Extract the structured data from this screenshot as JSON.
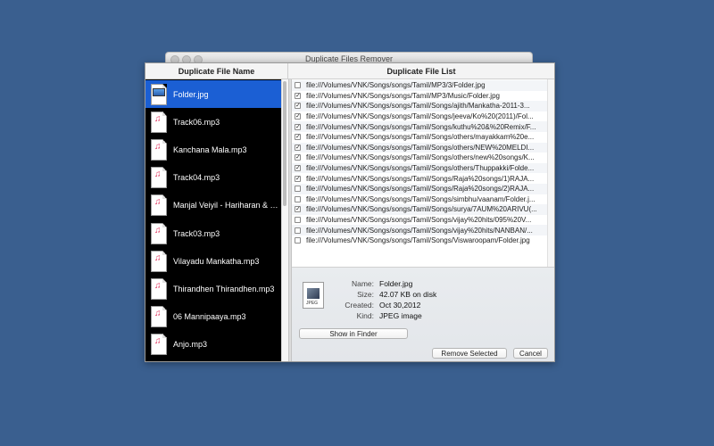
{
  "window": {
    "title": "Duplicate Files Remover"
  },
  "headers": {
    "left": "Duplicate File Name",
    "right": "Duplicate File List"
  },
  "files": [
    {
      "name": "Folder.jpg",
      "type": "image",
      "selected": true
    },
    {
      "name": "Track06.mp3",
      "type": "audio",
      "selected": false
    },
    {
      "name": "Kanchana Mala.mp3",
      "type": "audio",
      "selected": false
    },
    {
      "name": "Track04.mp3",
      "type": "audio",
      "selected": false
    },
    {
      "name": "Manjal Veiyil - Hariharan & Vija...",
      "type": "audio",
      "selected": false
    },
    {
      "name": "Track03.mp3",
      "type": "audio",
      "selected": false
    },
    {
      "name": "Vilayadu Mankatha.mp3",
      "type": "audio",
      "selected": false
    },
    {
      "name": "Thirandhen Thirandhen.mp3",
      "type": "audio",
      "selected": false
    },
    {
      "name": "06 Mannipaaya.mp3",
      "type": "audio",
      "selected": false
    },
    {
      "name": "Anjo.mp3",
      "type": "audio",
      "selected": false
    }
  ],
  "duplicates": [
    {
      "path": "file:///Volumes/VNK/Songs/songs/Tamil/MP3/3/Folder.jpg",
      "checked": false
    },
    {
      "path": "file:///Volumes/VNK/Songs/songs/Tamil/MP3/Music/Folder.jpg",
      "checked": true
    },
    {
      "path": "file:///Volumes/VNK/Songs/songs/Tamil/Songs/ajith/Mankatha-2011-3...",
      "checked": true
    },
    {
      "path": "file:///Volumes/VNK/Songs/songs/Tamil/Songs/jeeva/Ko%20(2011)/Fol...",
      "checked": true
    },
    {
      "path": "file:///Volumes/VNK/Songs/songs/Tamil/Songs/kuthu%20&%20Remix/F...",
      "checked": true
    },
    {
      "path": "file:///Volumes/VNK/Songs/songs/Tamil/Songs/others/mayakkam%20e...",
      "checked": true
    },
    {
      "path": "file:///Volumes/VNK/Songs/songs/Tamil/Songs/others/NEW%20MELDI...",
      "checked": true
    },
    {
      "path": "file:///Volumes/VNK/Songs/songs/Tamil/Songs/others/new%20songs/K...",
      "checked": true
    },
    {
      "path": "file:///Volumes/VNK/Songs/songs/Tamil/Songs/others/Thuppakki/Folde...",
      "checked": true
    },
    {
      "path": "file:///Volumes/VNK/Songs/songs/Tamil/Songs/Raja%20songs/1)RAJA...",
      "checked": true
    },
    {
      "path": "file:///Volumes/VNK/Songs/songs/Tamil/Songs/Raja%20songs/2)RAJA...",
      "checked": false
    },
    {
      "path": "file:///Volumes/VNK/Songs/songs/Tamil/Songs/simbhu/vaanam/Folder.j...",
      "checked": false
    },
    {
      "path": "file:///Volumes/VNK/Songs/songs/Tamil/Songs/surya/7AUM%20ARIVU(...",
      "checked": true
    },
    {
      "path": "file:///Volumes/VNK/Songs/songs/Tamil/Songs/vijay%20hits/095%20V...",
      "checked": false
    },
    {
      "path": "file:///Volumes/VNK/Songs/songs/Tamil/Songs/vijay%20hits/NANBAN/...",
      "checked": false
    },
    {
      "path": "file:///Volumes/VNK/Songs/songs/Tamil/Songs/Viswaroopam/Folder.jpg",
      "checked": false
    }
  ],
  "info": {
    "name_key": "Name:",
    "name_val": "Folder.jpg",
    "size_key": "Size:",
    "size_val": "42.07 KB on disk",
    "created_key": "Created:",
    "created_val": "Oct 30,2012",
    "kind_key": "Kind:",
    "kind_val": "JPEG image",
    "icon_label": "JPEG"
  },
  "buttons": {
    "show_in_finder": "Show in Finder",
    "remove_selected": "Remove Selected",
    "cancel": "Cancel"
  },
  "colors": {
    "desktop": "#3a5f8f",
    "selection": "#1b5fd4"
  }
}
